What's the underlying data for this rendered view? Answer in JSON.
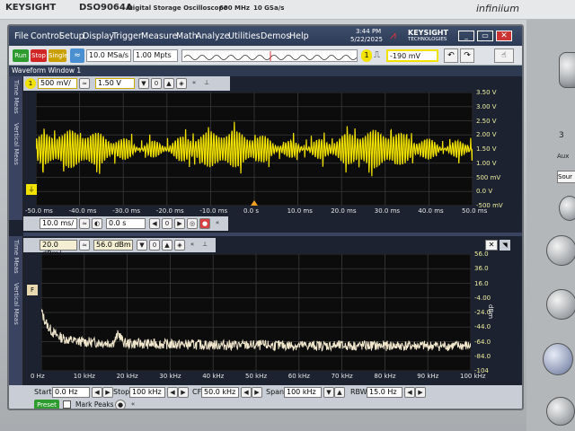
{
  "device": {
    "brand": "KEYSIGHT",
    "model": "DSO9064A",
    "model_desc": "Digital Storage Oscilloscope",
    "bandwidth": "600 MHz",
    "sample_rate_spec": "10 GSa/s",
    "infiniium_logo": "infiniium"
  },
  "menu": [
    "File",
    "Control",
    "Setup",
    "Display",
    "Trigger",
    "Measure",
    "Math",
    "Analyze",
    "Utilities",
    "Demos",
    "Help"
  ],
  "status": {
    "time": "3:44 PM",
    "date": "5/22/2025",
    "logo_line1": "KEYSIGHT",
    "logo_line2": "TECHNOLOGIES"
  },
  "toolbar": {
    "run": "Run",
    "stop": "Stop",
    "single": "Single",
    "sample_rate": "10.0 MSa/s",
    "memory_depth": "1.00 Mpts",
    "trigger_channel": "1",
    "trigger_level": "-190 mV"
  },
  "waveform_window": {
    "title": "Waveform Window 1"
  },
  "channel1": {
    "label": "1",
    "scale": "500 mV/",
    "offset": "1.50 V"
  },
  "side_tabs_top": [
    "Time Meas",
    "Vertical Meas"
  ],
  "side_tabs_bottom": [
    "Time Meas",
    "Vertical Meas"
  ],
  "timebase": {
    "scale": "10.0 ms/",
    "position": "0.0 s"
  },
  "fft": {
    "scale": "20.0 dBm/",
    "ref": "56.0 dBm",
    "unit": "dBm"
  },
  "fft_controls": {
    "start_label": "Start",
    "start": "0.0 Hz",
    "stop_label": "Stop",
    "stop": "100 kHz",
    "cf_label": "CF",
    "cf": "50.0 kHz",
    "span_label": "Span",
    "span": "100 kHz",
    "rbw_label": "RBW",
    "rbw": "15.0 Hz",
    "preset": "Preset",
    "mark_peaks": "Mark Peaks"
  },
  "front_panel": {
    "label_aux": "Aux",
    "label_sour": "Sour",
    "label_3": "3"
  },
  "chart_data": [
    {
      "type": "line",
      "title": "",
      "xlabel": "",
      "ylabel": "",
      "x_ticks": [
        "-50.0 ms",
        "-40.0 ms",
        "-30.0 ms",
        "-20.0 ms",
        "-10.0 ms",
        "0.0 s",
        "10.0 ms",
        "20.0 ms",
        "30.0 ms",
        "40.0 ms",
        "50.0 ms"
      ],
      "y_ticks": [
        "3.50 V",
        "3.00 V",
        "2.50 V",
        "2.00 V",
        "1.50 V",
        "1.00 V",
        "500 mV",
        "0.0 V",
        "-500 mV"
      ],
      "xlim": [
        -50,
        50
      ],
      "ylim": [
        -0.5,
        3.5
      ],
      "grid": true,
      "series": [
        {
          "color": "#f2e200",
          "center": 1.5,
          "amplitude": 0.35,
          "cycles": 170
        }
      ]
    },
    {
      "type": "line",
      "title": "",
      "xlabel": "",
      "ylabel": "dBm",
      "x_ticks": [
        "0 Hz",
        "10 kHz",
        "20 kHz",
        "30 kHz",
        "40 kHz",
        "50 kHz",
        "60 kHz",
        "70 kHz",
        "80 kHz",
        "90 kHz",
        "100 kHz"
      ],
      "y_ticks": [
        "56.0",
        "36.0",
        "16.0",
        "-4.00",
        "-24.0",
        "-44.0",
        "-64.0",
        "-84.0",
        "-104"
      ],
      "xlim": [
        0,
        100
      ],
      "ylim": [
        -104,
        56
      ],
      "grid": true,
      "series": [
        {
          "color": "#f0e6cc",
          "peak_x_khz": 18,
          "noise_floor_dbm": -70
        }
      ]
    }
  ]
}
